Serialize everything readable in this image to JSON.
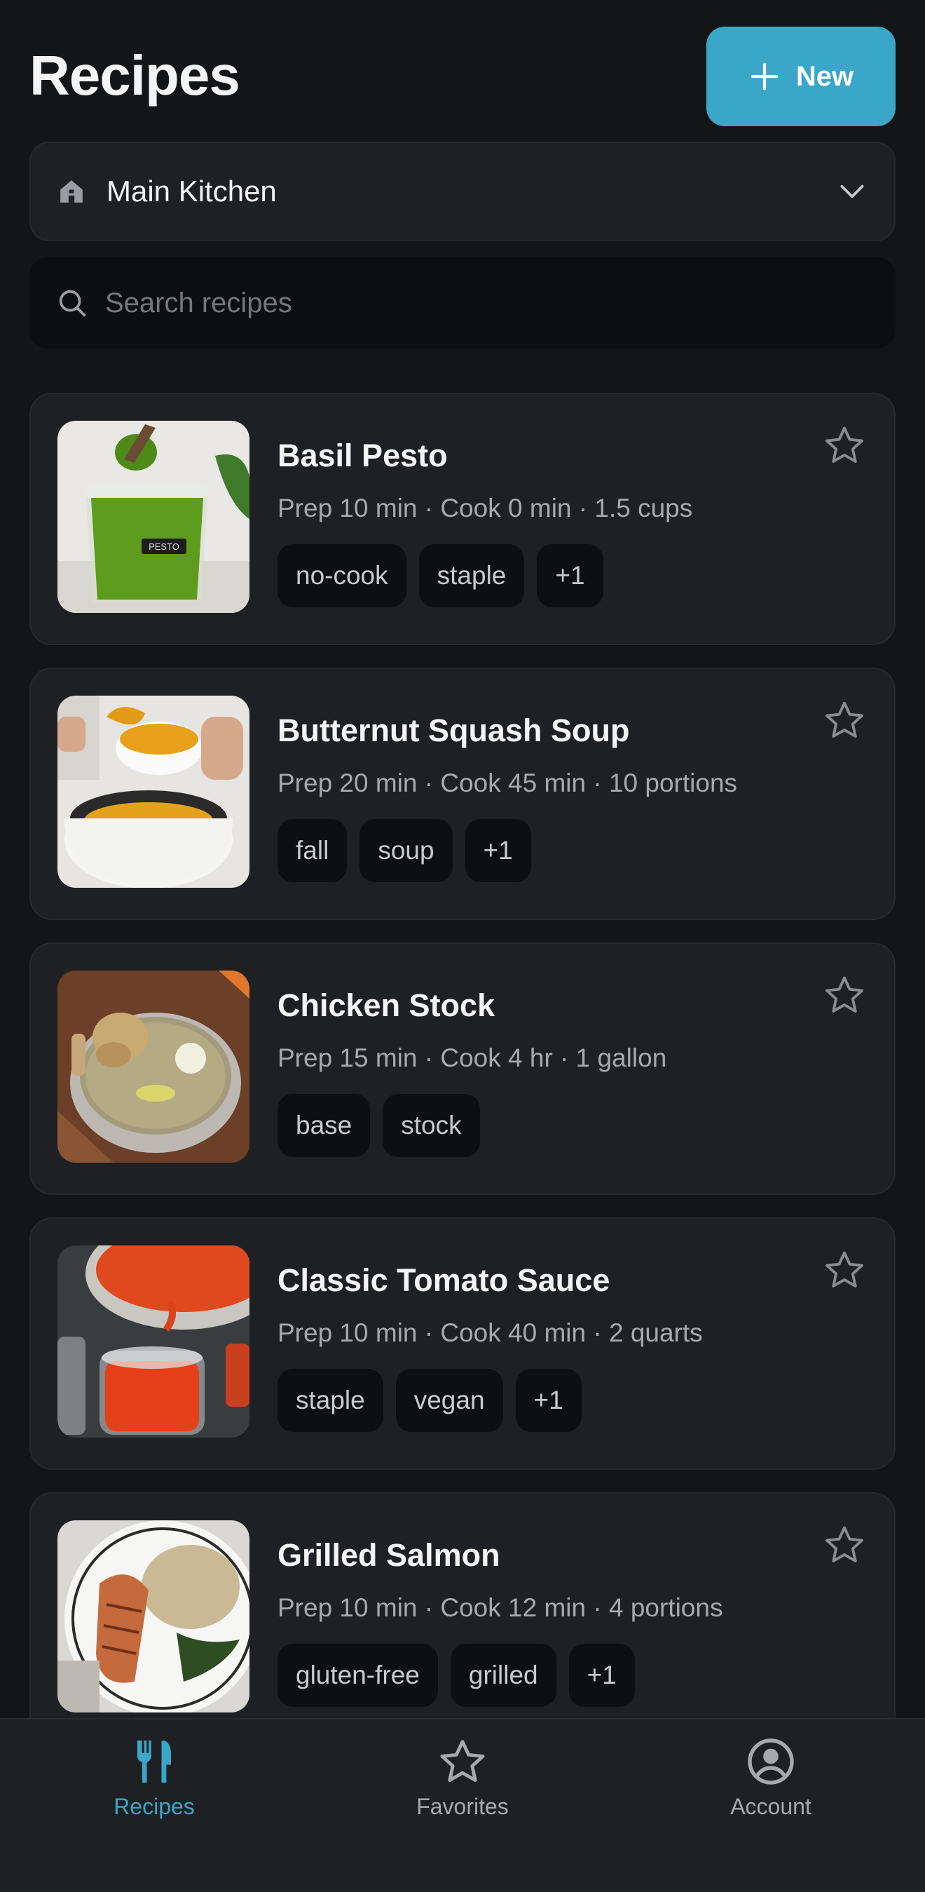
{
  "header": {
    "title": "Recipes",
    "new_label": "New"
  },
  "kitchen_selector": {
    "label": "Main Kitchen"
  },
  "search": {
    "placeholder": "Search recipes"
  },
  "recipes": [
    {
      "name": "Basil Pesto",
      "meta": "Prep 10 min · Cook 0 min · 1.5 cups",
      "tags": [
        "no-cook",
        "staple",
        "+1"
      ],
      "favorited": false
    },
    {
      "name": "Butternut Squash Soup",
      "meta": "Prep 20 min · Cook 45 min · 10 portions",
      "tags": [
        "fall",
        "soup",
        "+1"
      ],
      "favorited": false
    },
    {
      "name": "Chicken Stock",
      "meta": "Prep 15 min · Cook 4 hr · 1 gallon",
      "tags": [
        "base",
        "stock"
      ],
      "favorited": false
    },
    {
      "name": "Classic Tomato Sauce",
      "meta": "Prep 10 min · Cook 40 min · 2 quarts",
      "tags": [
        "staple",
        "vegan",
        "+1"
      ],
      "favorited": false
    },
    {
      "name": "Grilled Salmon",
      "meta": "Prep 10 min · Cook 12 min · 4 portions",
      "tags": [
        "gluten-free",
        "grilled",
        "+1"
      ],
      "favorited": false
    }
  ],
  "photo_label": "PESTO",
  "bottom_nav": {
    "items": [
      {
        "label": "Recipes",
        "icon": "fork-knife-icon",
        "active": true
      },
      {
        "label": "Favorites",
        "icon": "star-icon",
        "active": false
      },
      {
        "label": "Account",
        "icon": "account-icon",
        "active": false
      }
    ]
  },
  "colors": {
    "background": "#141517",
    "card": "#1f2023",
    "accent": "#3aa6c8",
    "tag_bg": "#0e0f11",
    "muted_text": "#a7a9ad"
  }
}
